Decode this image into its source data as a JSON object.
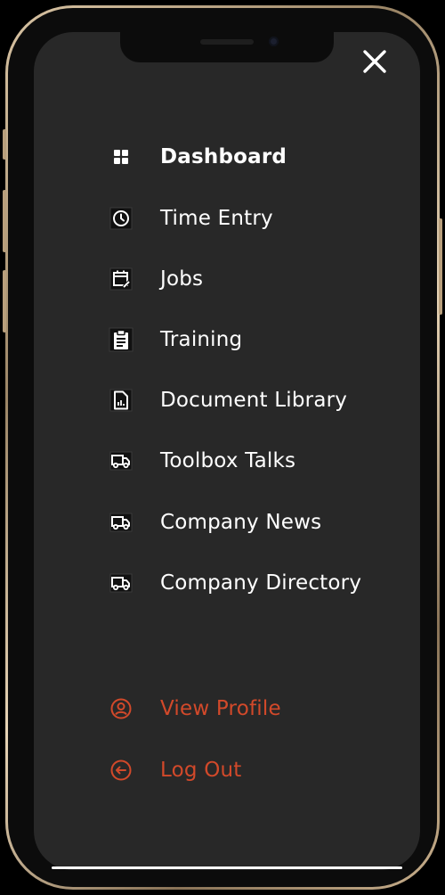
{
  "nav": {
    "close_label": "Close",
    "items": [
      {
        "label": "Dashboard",
        "icon": "dashboard-grid-icon",
        "active": true
      },
      {
        "label": "Time Entry",
        "icon": "clock-icon"
      },
      {
        "label": "Jobs",
        "icon": "calendar-edit-icon"
      },
      {
        "label": "Training",
        "icon": "clipboard-icon"
      },
      {
        "label": "Document Library",
        "icon": "document-chart-icon"
      },
      {
        "label": "Toolbox Talks",
        "icon": "truck-icon"
      },
      {
        "label": "Company News",
        "icon": "truck-icon"
      },
      {
        "label": "Company Directory",
        "icon": "truck-icon"
      }
    ]
  },
  "account": {
    "items": [
      {
        "label": "View Profile",
        "icon": "user-circle-icon"
      },
      {
        "label": "Log Out",
        "icon": "logout-arrow-icon"
      }
    ]
  },
  "colors": {
    "background": "#282828",
    "text": "#ffffff",
    "accent": "#d2492a",
    "frame_gold": "#c9b08d"
  }
}
